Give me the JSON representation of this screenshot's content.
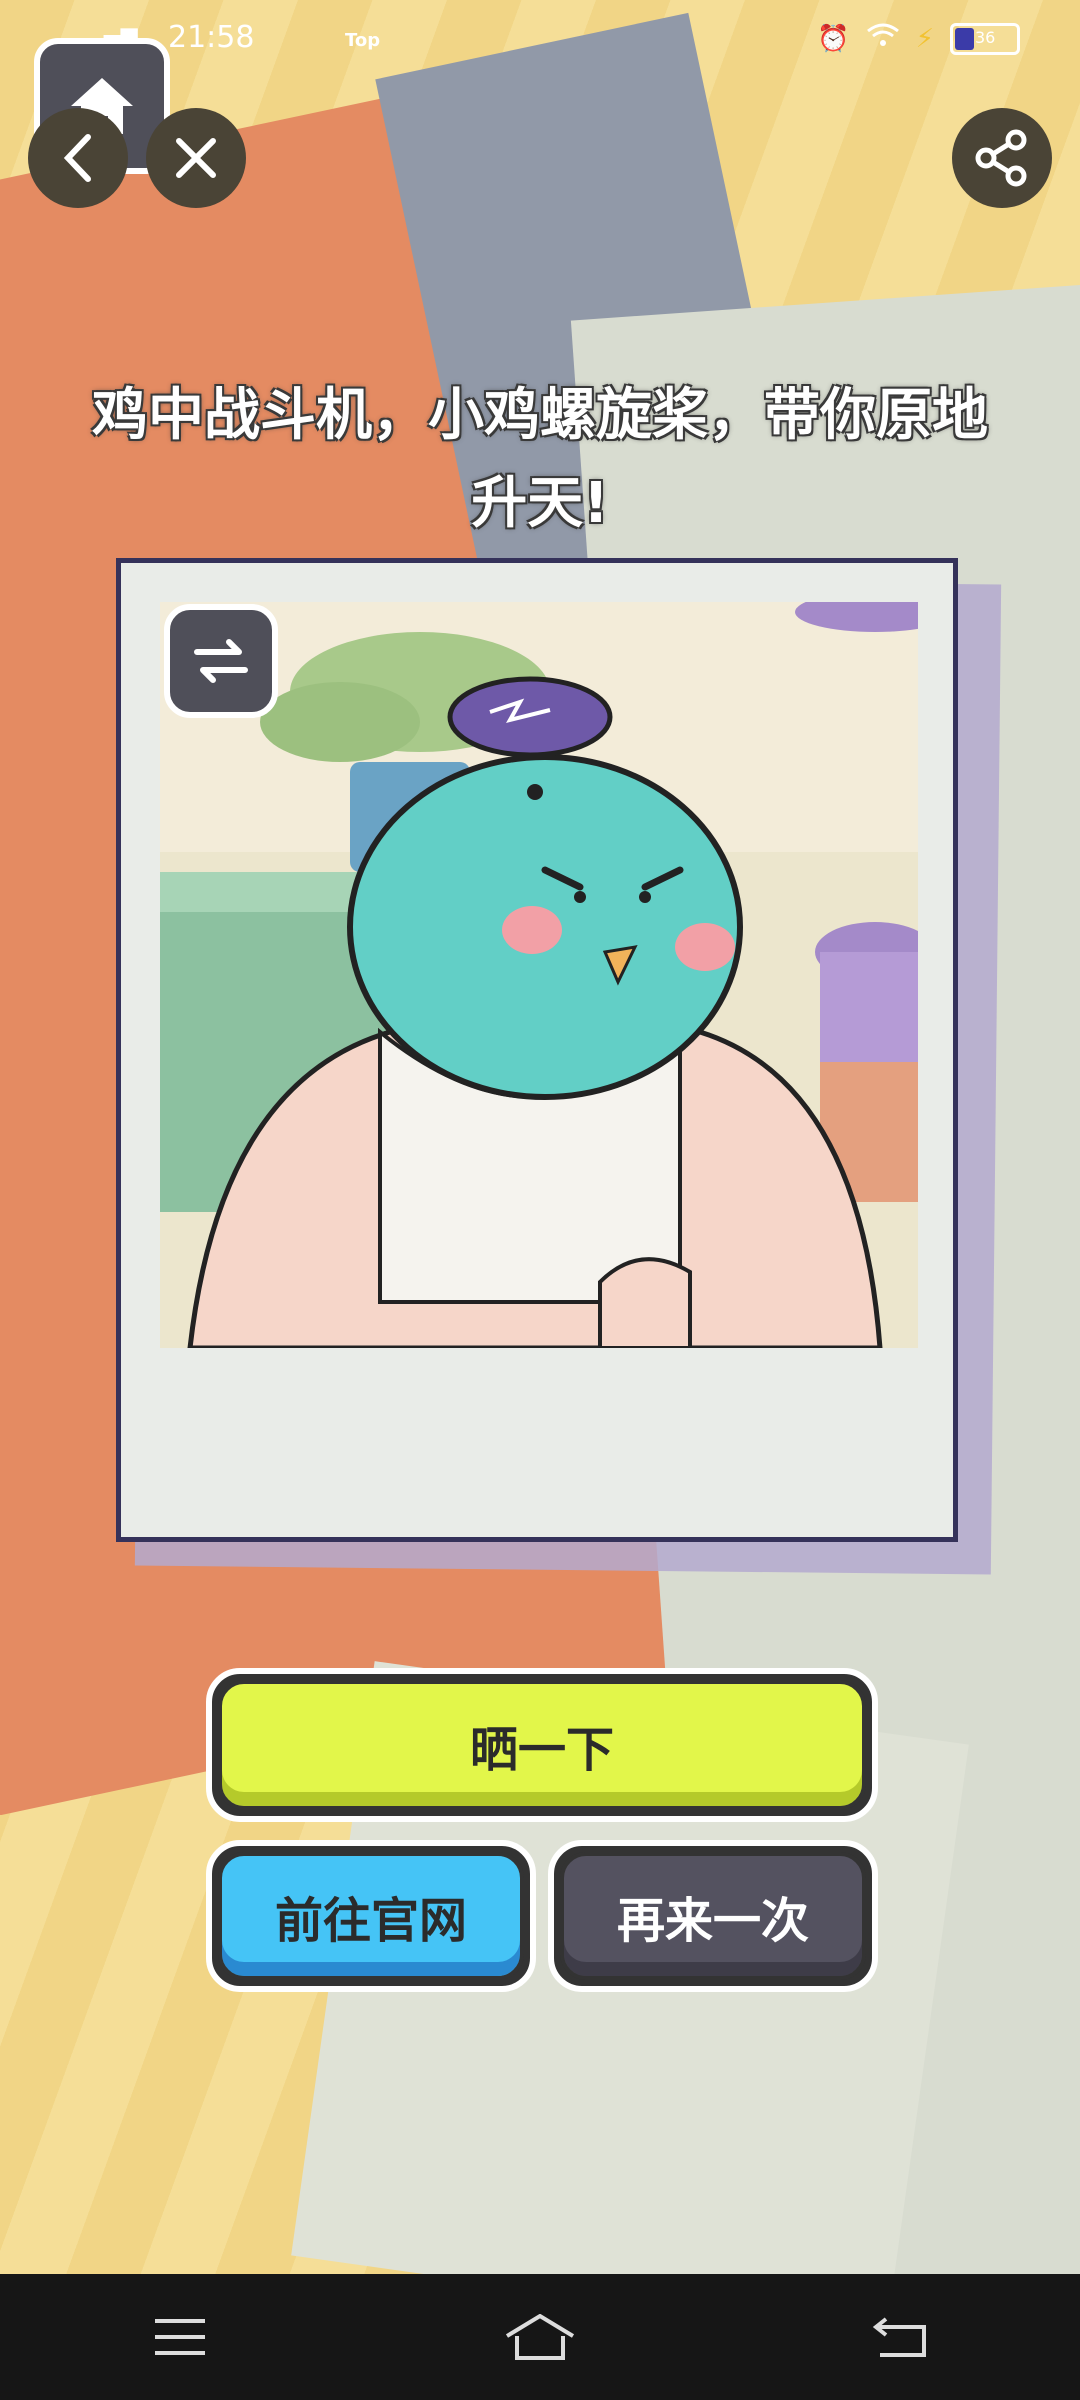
{
  "status_bar": {
    "time": "21:58",
    "app_tag": "Top",
    "battery": "36"
  },
  "headline": "鸡中战斗机，小鸡螺旋桨，带你原地升天!",
  "buttons": {
    "share_label": "晒一下",
    "official_site_label": "前往官网",
    "retry_label": "再来一次"
  },
  "icons": {
    "home": "home-icon",
    "back": "chevron-left-icon",
    "close": "close-icon",
    "share": "share-icon",
    "swap": "swap-icon",
    "menu": "menu-icon",
    "nav_home": "home-icon",
    "nav_back": "back-icon"
  },
  "colors": {
    "share_button": "#e2f64a",
    "site_button": "#45c4f6",
    "retry_button": "#545260"
  }
}
